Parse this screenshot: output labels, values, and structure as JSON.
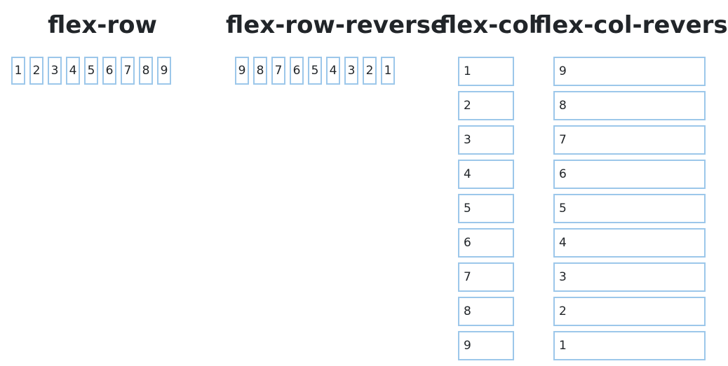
{
  "sections": [
    {
      "title": "flex-row",
      "items": [
        "1",
        "2",
        "3",
        "4",
        "5",
        "6",
        "7",
        "8",
        "9"
      ]
    },
    {
      "title": "flex-row-reverse",
      "items": [
        "9",
        "8",
        "7",
        "6",
        "5",
        "4",
        "3",
        "2",
        "1"
      ]
    },
    {
      "title": "flex-col",
      "items": [
        "1",
        "2",
        "3",
        "4",
        "5",
        "6",
        "7",
        "8",
        "9"
      ]
    },
    {
      "title": "flex-col-reverse",
      "items": [
        "9",
        "8",
        "7",
        "6",
        "5",
        "4",
        "3",
        "2",
        "1"
      ]
    }
  ],
  "colors": {
    "item_border": "#9cc7ea",
    "text": "#212529"
  }
}
